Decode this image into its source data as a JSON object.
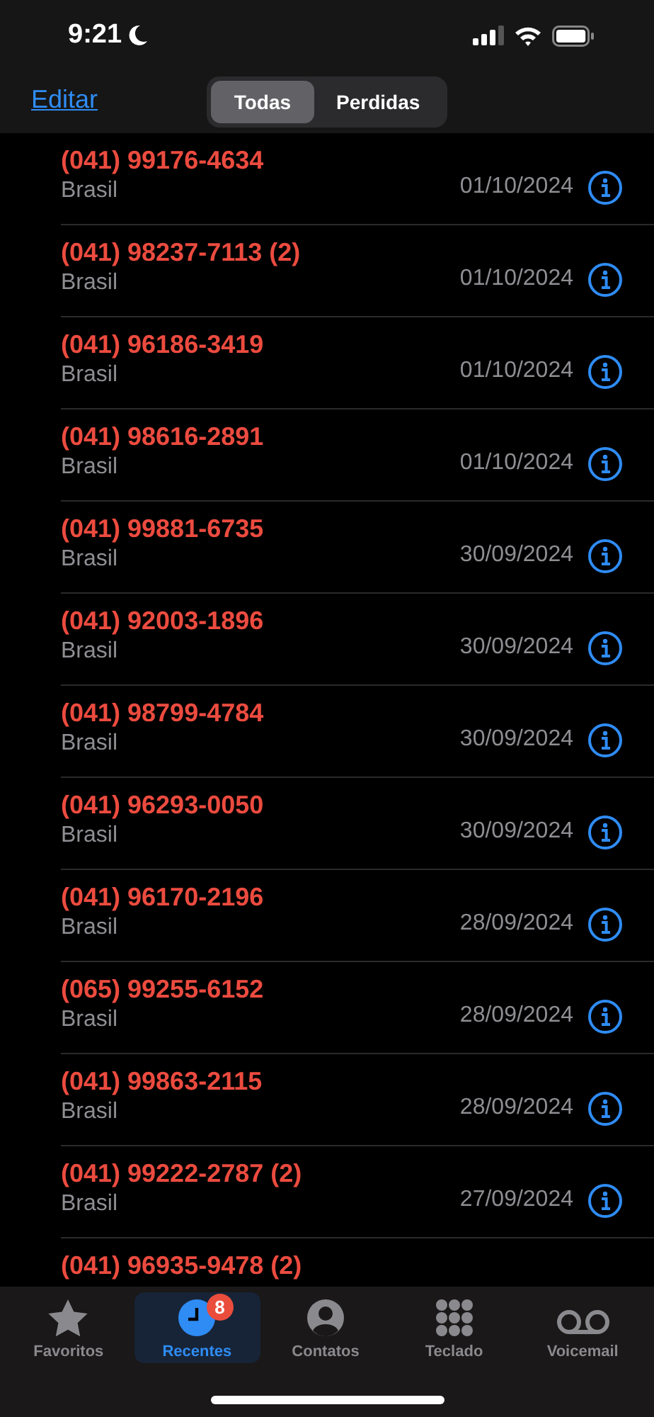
{
  "status_bar": {
    "time": "9:21"
  },
  "nav": {
    "edit": "Editar",
    "segments": [
      {
        "label": "Todas",
        "selected": true
      },
      {
        "label": "Perdidas",
        "selected": false
      }
    ]
  },
  "calls": [
    {
      "number": "(041) 99176-4634",
      "location": "Brasil",
      "date": "01/10/2024",
      "missed": true
    },
    {
      "number": "(041) 98237-7113 (2)",
      "location": "Brasil",
      "date": "01/10/2024",
      "missed": true
    },
    {
      "number": "(041) 96186-3419",
      "location": "Brasil",
      "date": "01/10/2024",
      "missed": true
    },
    {
      "number": "(041) 98616-2891",
      "location": "Brasil",
      "date": "01/10/2024",
      "missed": true
    },
    {
      "number": "(041) 99881-6735",
      "location": "Brasil",
      "date": "30/09/2024",
      "missed": true
    },
    {
      "number": "(041) 92003-1896",
      "location": "Brasil",
      "date": "30/09/2024",
      "missed": true
    },
    {
      "number": "(041) 98799-4784",
      "location": "Brasil",
      "date": "30/09/2024",
      "missed": true
    },
    {
      "number": "(041) 96293-0050",
      "location": "Brasil",
      "date": "30/09/2024",
      "missed": true
    },
    {
      "number": "(041) 96170-2196",
      "location": "Brasil",
      "date": "28/09/2024",
      "missed": true
    },
    {
      "number": "(065) 99255-6152",
      "location": "Brasil",
      "date": "28/09/2024",
      "missed": true
    },
    {
      "number": "(041) 99863-2115",
      "location": "Brasil",
      "date": "28/09/2024",
      "missed": true
    },
    {
      "number": "(041) 99222-2787 (2)",
      "location": "Brasil",
      "date": "27/09/2024",
      "missed": true
    },
    {
      "number": "(041) 96935-9478 (2)",
      "missed": true
    }
  ],
  "tab_bar": [
    {
      "kind": "star",
      "label": "Favoritos",
      "selected": false
    },
    {
      "kind": "clock",
      "label": "Recentes",
      "selected": true,
      "badge": "8"
    },
    {
      "kind": "person",
      "label": "Contatos",
      "selected": false
    },
    {
      "kind": "keypad",
      "label": "Teclado",
      "selected": false
    },
    {
      "kind": "voicemail",
      "label": "Voicemail",
      "selected": false
    }
  ]
}
